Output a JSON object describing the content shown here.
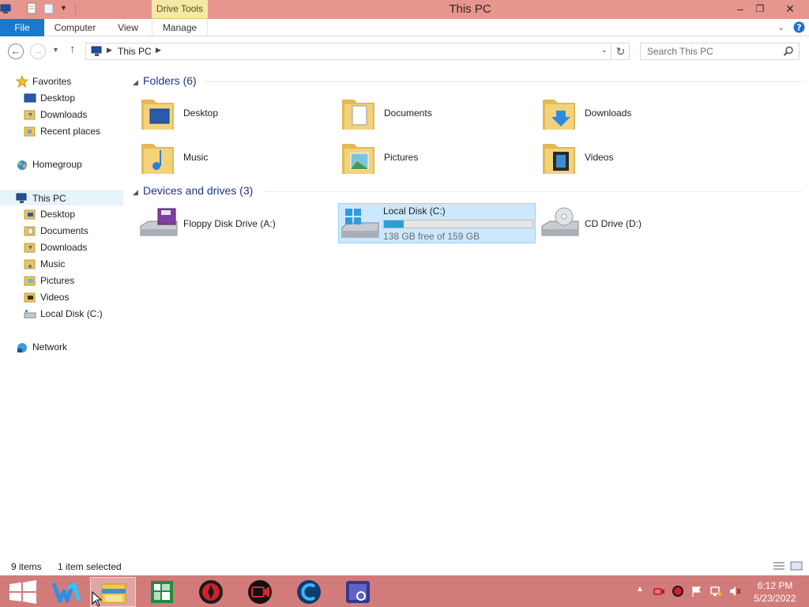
{
  "window": {
    "title": "This PC",
    "context_tab_group": "Drive Tools",
    "controls": {
      "minimize": "–",
      "restore": "❐",
      "close": "✕"
    }
  },
  "ribbon": {
    "tabs": [
      "File",
      "Computer",
      "View",
      "Manage"
    ]
  },
  "address": {
    "path": "This PC",
    "search_placeholder": "Search This PC"
  },
  "nav": {
    "favorites": {
      "label": "Favorites",
      "items": [
        "Desktop",
        "Downloads",
        "Recent places"
      ]
    },
    "homegroup": "Homegroup",
    "this_pc": {
      "label": "This PC",
      "items": [
        "Desktop",
        "Documents",
        "Downloads",
        "Music",
        "Pictures",
        "Videos",
        "Local Disk (C:)"
      ]
    },
    "network": "Network"
  },
  "content": {
    "folders_header": "Folders (6)",
    "folders": [
      "Desktop",
      "Documents",
      "Downloads",
      "Music",
      "Pictures",
      "Videos"
    ],
    "devices_header": "Devices and drives (3)",
    "devices": [
      {
        "label": "Floppy Disk Drive (A:)",
        "icon": "floppy-drive-icon"
      },
      {
        "label": "Local Disk (C:)",
        "icon": "hard-disk-icon",
        "free": "138 GB free of 159 GB",
        "used_fraction": 0.132,
        "selected": true
      },
      {
        "label": "CD Drive (D:)",
        "icon": "cd-drive-icon"
      }
    ]
  },
  "status": {
    "item_count": "9 items",
    "selection": "1 item selected"
  },
  "taskbar": {
    "apps": [
      "start-button",
      "writer-app",
      "file-explorer",
      "spreadsheet-app",
      "antivirus-app",
      "screen-recorder-app",
      "ccleaner-app",
      "screenshot-tool-app"
    ],
    "clock_time": "6:12 PM",
    "clock_date": "5/23/2022"
  },
  "colors": {
    "titlebar": "#e6968e",
    "file_tab": "#1979ca",
    "context_group": "#f7e8a6",
    "group_header": "#1e3287",
    "taskbar": "#d27b7b",
    "selection": "#cce8ff",
    "storage_bar": "#26a0da"
  }
}
